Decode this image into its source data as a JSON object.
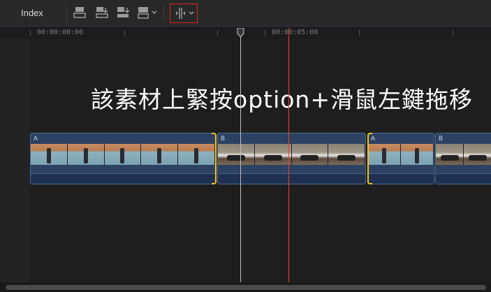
{
  "toolbar": {
    "index_label": "Index",
    "tools": [
      {
        "icon": "append-clip-icon"
      },
      {
        "icon": "insert-clip-icon"
      },
      {
        "icon": "overwrite-clip-icon"
      },
      {
        "icon": "connect-clip-icon"
      },
      {
        "icon": "trim-tool-icon"
      }
    ]
  },
  "ruler": {
    "timecodes": [
      "00:00:00:00",
      "00:00:05:00"
    ]
  },
  "overlay_caption": "該素材上緊按option+滑鼠左鍵拖移",
  "clips": [
    {
      "label": "A",
      "kind": "A"
    },
    {
      "label": "B",
      "kind": "B"
    },
    {
      "label": "A",
      "kind": "A"
    },
    {
      "label": "B",
      "kind": "B"
    }
  ],
  "colors": {
    "accent_selection": "#f4c21b",
    "skimmer": "#e2452d",
    "highlight_box": "#e02020",
    "clip_fill": "#2d4263"
  }
}
